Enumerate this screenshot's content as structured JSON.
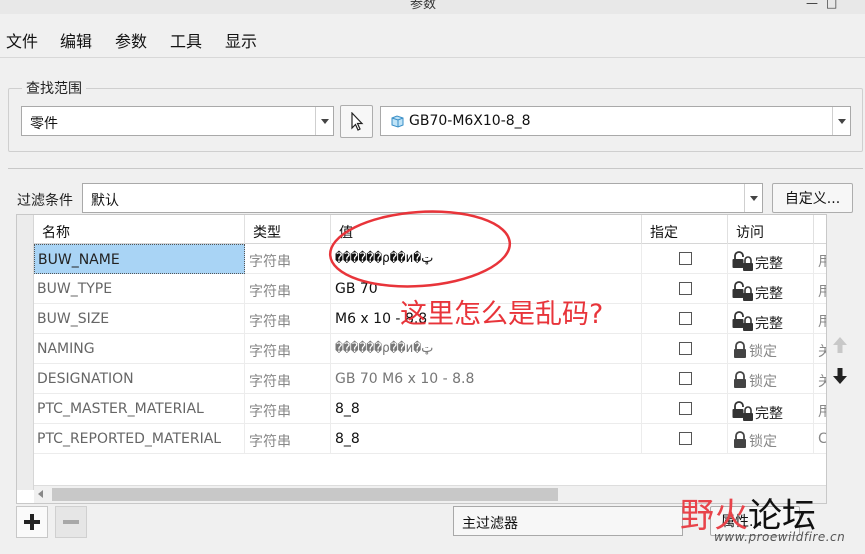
{
  "window": {
    "title": "参数",
    "controls": [
      "—",
      "□"
    ]
  },
  "menu": [
    "文件",
    "编辑",
    "参数",
    "工具",
    "显示"
  ],
  "search_scope": {
    "label": "查找范围",
    "type_value": "零件",
    "model_value": "GB70-M6X10-8_8"
  },
  "filter": {
    "label": "过滤条件",
    "value": "默认",
    "custom_button": "自定义..."
  },
  "table": {
    "columns": [
      "名称",
      "类型",
      "值",
      "指定",
      "访问"
    ],
    "rows": [
      {
        "name": "BUW_NAME",
        "type": "字符串",
        "value": "������ρ��и�ټ",
        "access": "完整",
        "extra": "用",
        "selected": true,
        "editable": true
      },
      {
        "name": "BUW_TYPE",
        "type": "字符串",
        "value": "GB 70",
        "access": "完整",
        "extra": "用",
        "selected": false,
        "editable": true
      },
      {
        "name": "BUW_SIZE",
        "type": "字符串",
        "value": "M6 x 10 - 8.8",
        "access": "完整",
        "extra": "用",
        "selected": false,
        "editable": true
      },
      {
        "name": "NAMING",
        "type": "字符串",
        "value": "������ρ��и�ټ",
        "access": "锁定",
        "extra": "关",
        "selected": false,
        "editable": false
      },
      {
        "name": "DESIGNATION",
        "type": "字符串",
        "value": "GB 70 M6 x 10 - 8.8",
        "access": "锁定",
        "extra": "关",
        "selected": false,
        "editable": false
      },
      {
        "name": "PTC_MASTER_MATERIAL",
        "type": "字符串",
        "value": "8_8",
        "access": "完整",
        "extra": "用",
        "selected": false,
        "editable": true
      },
      {
        "name": "PTC_REPORTED_MATERIAL",
        "type": "字符串",
        "value": "8_8",
        "access": "锁定",
        "extra": "C",
        "selected": false,
        "editable": true
      }
    ]
  },
  "annotation": {
    "text": "这里怎么是乱码?",
    "color": "#e8343a"
  },
  "bottom": {
    "main_filter": "主过滤器",
    "properties_button": "属性..."
  },
  "watermark": {
    "brand_a": "野火",
    "brand_b": "论坛",
    "url": "www.proewildfire.cn"
  },
  "icons": {
    "pointer": "arrow-pointer-icon",
    "part": "part-cube-icon",
    "unlock": "unlock-icon",
    "lock": "lock-icon",
    "up": "arrow-up-icon",
    "down": "arrow-down-icon",
    "add": "plus-icon",
    "remove": "minus-icon"
  },
  "colors": {
    "selection": "#a9d4f5",
    "annotation": "#e8343a"
  }
}
